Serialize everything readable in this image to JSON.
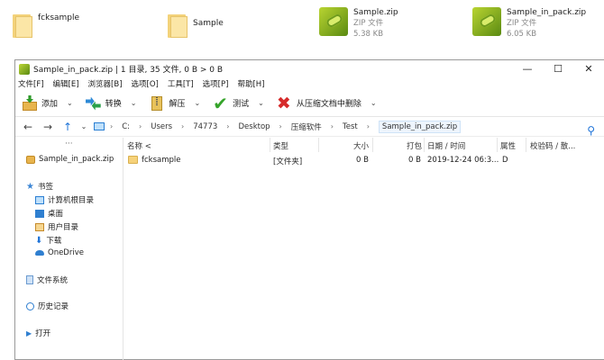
{
  "desktop": {
    "items": [
      {
        "name": "fcksample",
        "type": "",
        "size": ""
      },
      {
        "name": "Sample",
        "type": "",
        "size": ""
      },
      {
        "name": "Sample.zip",
        "type": "ZIP 文件",
        "size": "5.38 KB"
      },
      {
        "name": "Sample_in_pack.zip",
        "type": "ZIP 文件",
        "size": "6.05 KB"
      }
    ]
  },
  "window": {
    "title": "Sample_in_pack.zip | 1 目录,  35 文件,  0 B > 0 B",
    "controls": {
      "minimize": "—",
      "maximize": "☐",
      "close": "✕"
    }
  },
  "menu": [
    "文件[F]",
    "编辑[E]",
    "浏览器[B]",
    "选项[O]",
    "工具[T]",
    "选项[P]",
    "帮助[H]"
  ],
  "toolbar": {
    "add": "添加",
    "convert": "转换",
    "extract": "解压",
    "test": "测试",
    "delete": "从压缩文档中删除",
    "caret": "⌄"
  },
  "address": {
    "back": "←",
    "forward": "→",
    "up": "↑",
    "history": "⌄",
    "path": [
      "C:",
      "Users",
      "74773",
      "Desktop",
      "压缩软件",
      "Test",
      "Sample_in_pack.zip"
    ],
    "separator": "›"
  },
  "sidebar": {
    "dots": "···",
    "archive": "Sample_in_pack.zip",
    "bookmarks": "书签",
    "bookmark_items": [
      "计算机根目录",
      "桌面",
      "用户目录",
      "下载",
      "OneDrive"
    ],
    "filesystem": "文件系统",
    "history": "历史记录",
    "open": "打开"
  },
  "columns": {
    "name": "名称 <",
    "type": "类型",
    "size": "大小",
    "packed": "打包",
    "date": "日期 / 时间",
    "attr": "属性",
    "checksum": "校验码 / 散..."
  },
  "rows": [
    {
      "name": "fcksample",
      "type": "[文件夹]",
      "size": "0 B",
      "packed": "0 B",
      "date": "2019-12-24 06:3...",
      "attr": "D",
      "checksum": ""
    }
  ],
  "icons": {
    "add": "add-icon",
    "convert": "convert-icon",
    "extract": "extract-icon",
    "test": "test-check-icon",
    "delete": "delete-x-icon",
    "search": "search-icon"
  }
}
